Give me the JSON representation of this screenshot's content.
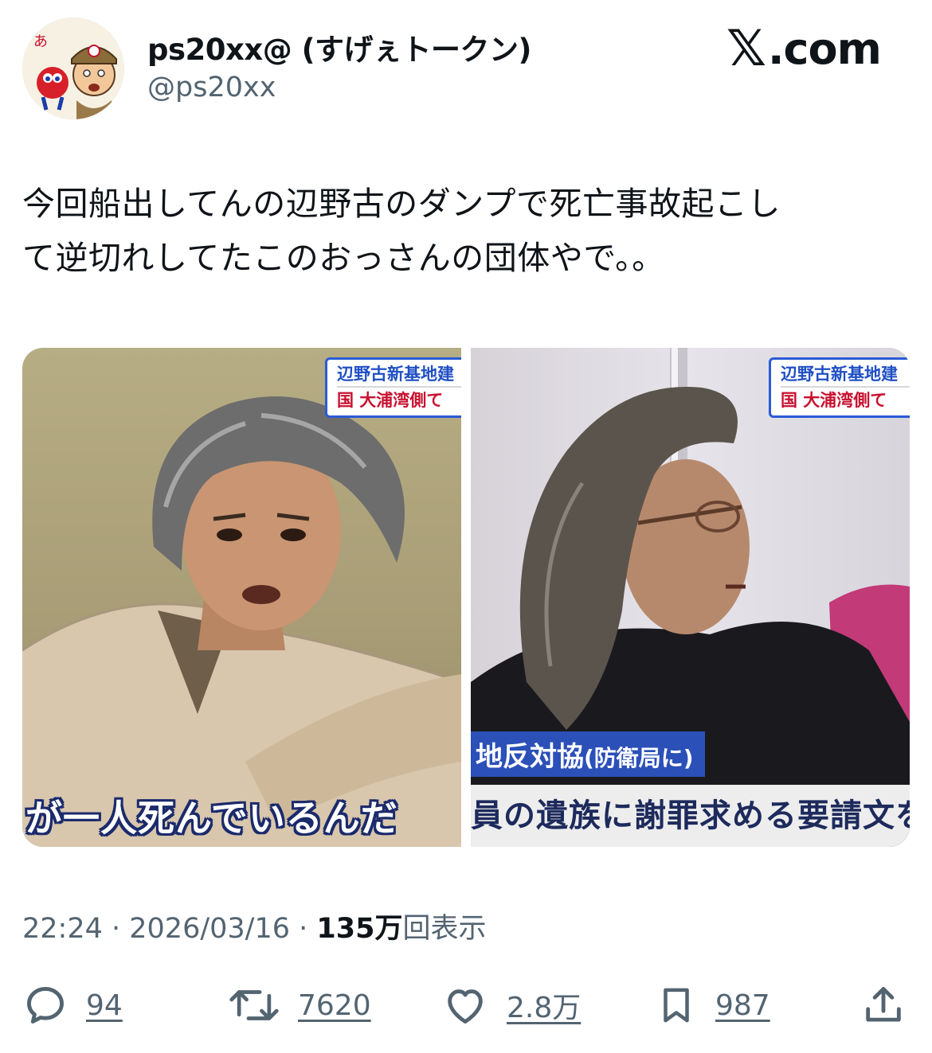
{
  "author": {
    "display_name": "ps20xx@ (すげぇトークン)",
    "handle": "@ps20xx"
  },
  "source": {
    "domain": "com",
    "icon": "x-logo-icon"
  },
  "tweet": {
    "text": "今回船出してんの辺野古のダンプで死亡事故起こし\nて逆切れしてたこのおっさんの団体やで。。"
  },
  "media": {
    "photo1": {
      "tag_top": "辺野古新基地建",
      "tag_bottom": "国 大浦湾側て",
      "caption": "が一人死んでいるんだ"
    },
    "photo2": {
      "tag_top": "辺野古新基地建",
      "tag_bottom": "国 大浦湾側て",
      "subtitle_main": "地反対協",
      "subtitle_paren": "(防衛局に)",
      "caption": "員の遺族に謝罪求める要請文を"
    }
  },
  "meta": {
    "time": "22:24",
    "separator": " · ",
    "date": "2026/03/16",
    "views_number": "135万",
    "views_label": "回表示"
  },
  "actions": {
    "replies": "94",
    "retweets": "7620",
    "likes": "2.8万",
    "bookmarks": "987"
  },
  "colors": {
    "text": "#0f1419",
    "secondary": "#536471",
    "tv_blue": "#2b50b8",
    "tv_red": "#c8102e"
  }
}
